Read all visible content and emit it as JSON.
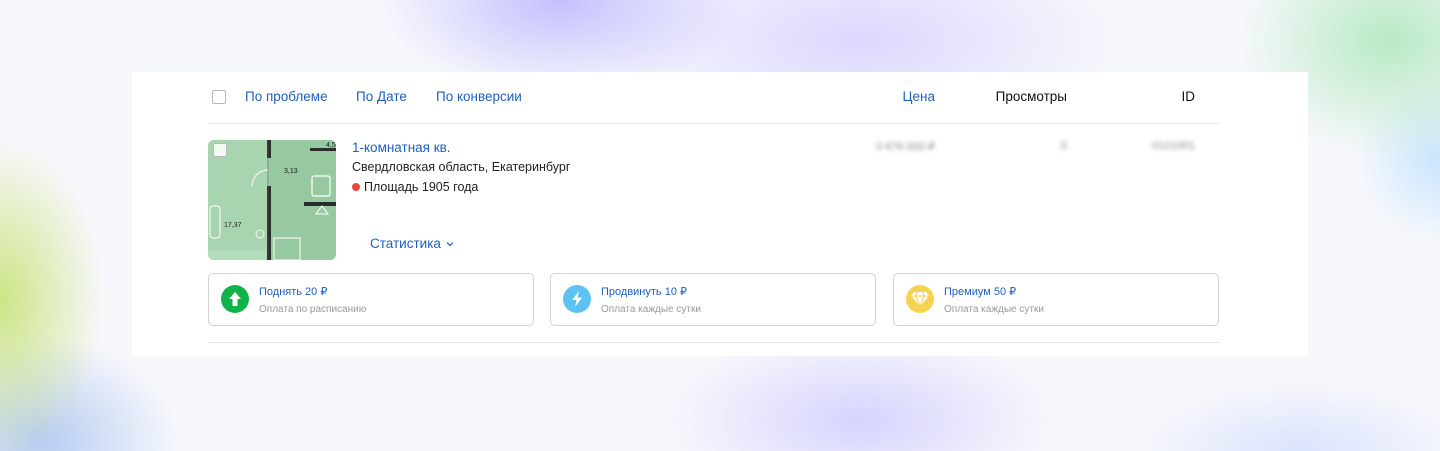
{
  "header": {
    "sort_links": [
      "По проблеме",
      "По Дате",
      "По конверсии"
    ],
    "col_price": "Цена",
    "col_views": "Просмотры",
    "col_id": "ID"
  },
  "listing": {
    "title": "1-комнатная кв.",
    "address": "Свердловская область, Екатеринбург",
    "status_text": "Площадь 1905 года",
    "status_color": "#e8453c",
    "price_blurred": "0 676 000 ₽",
    "views_blurred": "0",
    "id_blurred": "0121001",
    "plan_labels": [
      "4,5",
      "3,13",
      "17,37"
    ],
    "stats_label": "Статистика"
  },
  "promos": [
    {
      "label": "Поднять 20 ₽",
      "sub": "Оплата по расписанию",
      "icon": "arrow-up-icon",
      "color": "#10b24a"
    },
    {
      "label": "Продвинуть 10 ₽",
      "sub": "Оплата каждые сутки",
      "icon": "lightning-icon",
      "color": "#5cc2f2"
    },
    {
      "label": "Премиум 50 ₽",
      "sub": "Оплата каждые сутки",
      "icon": "diamond-icon",
      "color": "#f5d252"
    }
  ]
}
